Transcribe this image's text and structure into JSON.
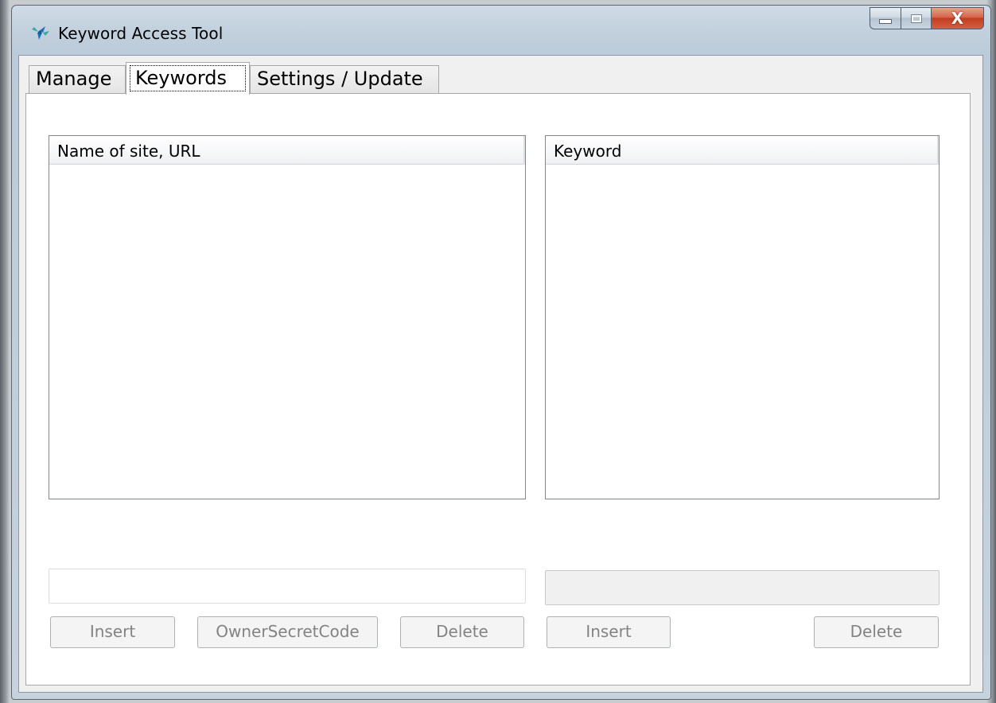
{
  "window": {
    "title": "Keyword Access Tool",
    "close_glyph": "X"
  },
  "tabs": [
    {
      "label": "Manage",
      "selected": false
    },
    {
      "label": "Keywords",
      "selected": true
    },
    {
      "label": "Settings / Update",
      "selected": false
    }
  ],
  "sites_list": {
    "column_header": "Name of site, URL",
    "rows": []
  },
  "keywords_list": {
    "column_header": "Keyword",
    "rows": []
  },
  "site_input": {
    "value": "",
    "placeholder": "",
    "enabled": true
  },
  "keyword_input": {
    "value": "",
    "placeholder": "",
    "enabled": false
  },
  "buttons": {
    "insert_site": "Insert",
    "owner_secret_code": "OwnerSecretCode",
    "delete_site": "Delete",
    "insert_keyword": "Insert",
    "delete_keyword": "Delete"
  },
  "icons": {
    "app": "keyword-tool-app-icon",
    "minimize": "minimize-icon",
    "maximize": "maximize-icon",
    "close": "close-icon"
  },
  "colors": {
    "close_button": "#c33d21",
    "disabled_text": "#838383",
    "app_icon_blue": "#1f6fb5",
    "app_icon_teal": "#3aa6a0"
  }
}
